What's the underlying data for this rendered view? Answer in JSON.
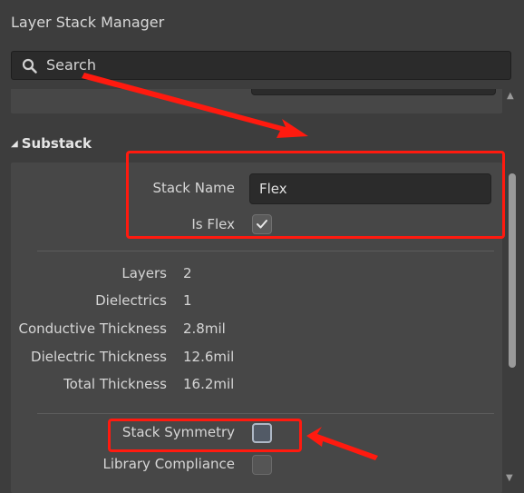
{
  "panel": {
    "title": "Layer Stack Manager"
  },
  "search": {
    "placeholder": "Search",
    "icon": "search-icon"
  },
  "substack": {
    "header": "Substack",
    "stack_name_label": "Stack Name",
    "stack_name_value": "Flex",
    "is_flex_label": "Is Flex",
    "is_flex_checked": true,
    "stats": [
      {
        "label": "Layers",
        "value": "2"
      },
      {
        "label": "Dielectrics",
        "value": "1"
      },
      {
        "label": "Conductive Thickness",
        "value": "2.8mil"
      },
      {
        "label": "Dielectric Thickness",
        "value": "12.6mil"
      },
      {
        "label": "Total Thickness",
        "value": "16.2mil"
      }
    ],
    "stack_symmetry_label": "Stack Symmetry",
    "stack_symmetry_checked": false,
    "library_compliance_label": "Library Compliance",
    "library_compliance_checked": false
  },
  "colors": {
    "annotation": "#ff1a0f",
    "panel_bg": "#3d3d3d",
    "box_bg": "#474747",
    "field_bg": "#2b2b2b"
  }
}
